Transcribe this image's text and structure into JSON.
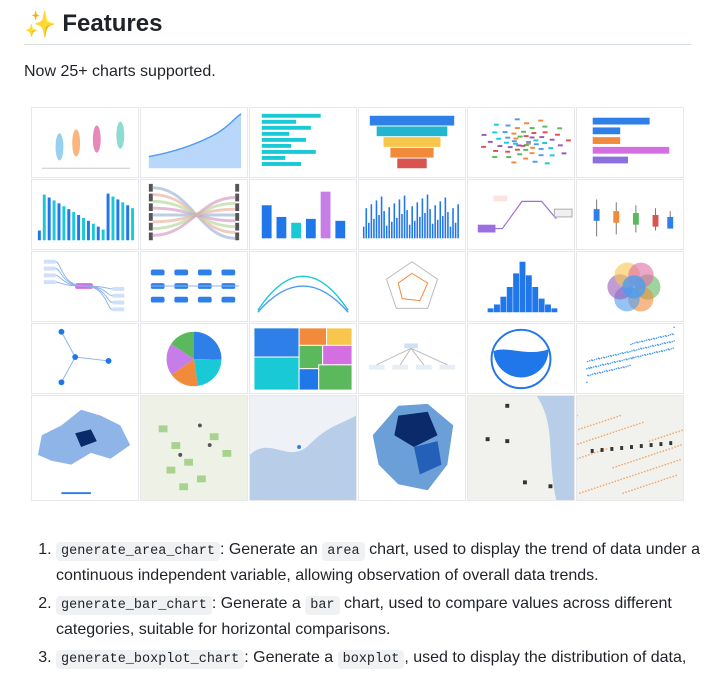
{
  "heading": {
    "icon": "sparkles-icon",
    "title": "Features"
  },
  "intro": "Now 25+ charts supported.",
  "gallery": {
    "thumbnails": [
      "violin-chart",
      "area-chart",
      "horizontal-bar-chart",
      "funnel-chart",
      "word-cloud-chart",
      "bar-chart",
      "column-chart",
      "sankey-chart",
      "column-chart-simple",
      "dense-column-chart",
      "fishbone-diagram",
      "boxplot-chart",
      "mind-map",
      "flow-diagram",
      "line-chart",
      "radar-chart",
      "histogram-chart",
      "venn-chart",
      "network-graph",
      "pie-chart",
      "treemap-chart",
      "organization-chart",
      "liquid-chart",
      "scatter-chart",
      "district-map",
      "pin-map",
      "path-map",
      "province-map",
      "location-map",
      "heat-map"
    ]
  },
  "features": [
    {
      "code": "generate_area_chart",
      "prefix": ": Generate an ",
      "inline_code": "area",
      "rest": " chart, used to display the trend of data under a continuous independent variable, allowing observation of overall data trends."
    },
    {
      "code": "generate_bar_chart",
      "prefix": ": Generate a ",
      "inline_code": "bar",
      "rest": " chart, used to compare values across different categories, suitable for horizontal comparisons."
    },
    {
      "code": "generate_boxplot_chart",
      "prefix": ": Generate a ",
      "inline_code": "boxplot",
      "rest": ", used to display the distribution of data,"
    }
  ]
}
